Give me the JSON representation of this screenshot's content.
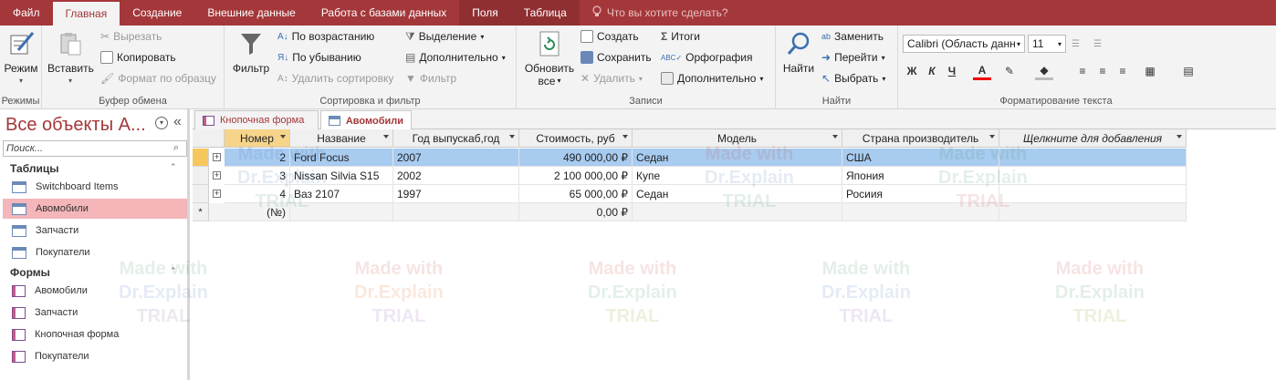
{
  "tabs": {
    "file": "Файл",
    "home": "Главная",
    "create": "Создание",
    "external": "Внешние данные",
    "dbtools": "Работа с базами данных",
    "fields": "Поля",
    "table": "Таблица",
    "tellme": "Что вы хотите сделать?"
  },
  "ribbon": {
    "views": {
      "view": "Режим",
      "label": "Режимы"
    },
    "clipboard": {
      "paste": "Вставить",
      "cut": "Вырезать",
      "copy": "Копировать",
      "format_painter": "Формат по образцу",
      "label": "Буфер обмена"
    },
    "sort": {
      "filter": "Фильтр",
      "asc": "По возрастанию",
      "desc": "По убыванию",
      "remove": "Удалить сортировку",
      "selection": "Выделение",
      "advanced": "Дополнительно",
      "toggle": "Фильтр",
      "label": "Сортировка и фильтр"
    },
    "records": {
      "refresh": "Обновить",
      "refresh2": "все",
      "new": "Создать",
      "save": "Сохранить",
      "delete": "Удалить",
      "totals": "Итоги",
      "spelling": "Орфография",
      "more": "Дополнительно",
      "label": "Записи"
    },
    "find": {
      "find": "Найти",
      "replace": "Заменить",
      "goto": "Перейти",
      "select": "Выбрать",
      "label": "Найти"
    },
    "text": {
      "font": "Calibri (Область данных)",
      "size": "11",
      "bold": "Ж",
      "italic": "К",
      "underline": "Ч",
      "font_color_letter": "А",
      "label": "Форматирование текста"
    }
  },
  "nav": {
    "title": "Все объекты А...",
    "search_placeholder": "Поиск...",
    "sections": [
      {
        "label": "Таблицы",
        "items": [
          "Switchboard Items",
          "Авомобили",
          "Запчасти",
          "Покупатели"
        ]
      },
      {
        "label": "Формы",
        "items": [
          "Авомобили",
          "Запчасти",
          "Кнопочная форма",
          "Покупатели"
        ]
      }
    ]
  },
  "doc_tabs": [
    "Кнопочная форма",
    "Авомобили"
  ],
  "table": {
    "columns": [
      "Номер",
      "Название",
      "Год выпускаб,год",
      "Стоимость, руб",
      "Модель",
      "Страна производитель",
      "Щелкните для добавления"
    ],
    "rows": [
      [
        "2",
        "Ford Focus",
        "2007",
        "490 000,00 ₽",
        "Седан",
        "США"
      ],
      [
        "3",
        "Nissan Silvia S15",
        "2002",
        "2 100 000,00 ₽",
        "Купе",
        "Япония"
      ],
      [
        "4",
        "Ваз 2107",
        "1997",
        "65 000,00 ₽",
        "Седан",
        "Росиия"
      ]
    ],
    "new_row": [
      "(№)",
      "0,00 ₽"
    ],
    "new_row_marker": "*"
  },
  "watermark": {
    "line1": "Made with",
    "line2": "Dr.Explain",
    "line3": "TRIAL"
  },
  "colors": {
    "accent": "#a4373a",
    "selected_row": "#a8cbf0",
    "nav_selected": "#f4b6b9"
  }
}
